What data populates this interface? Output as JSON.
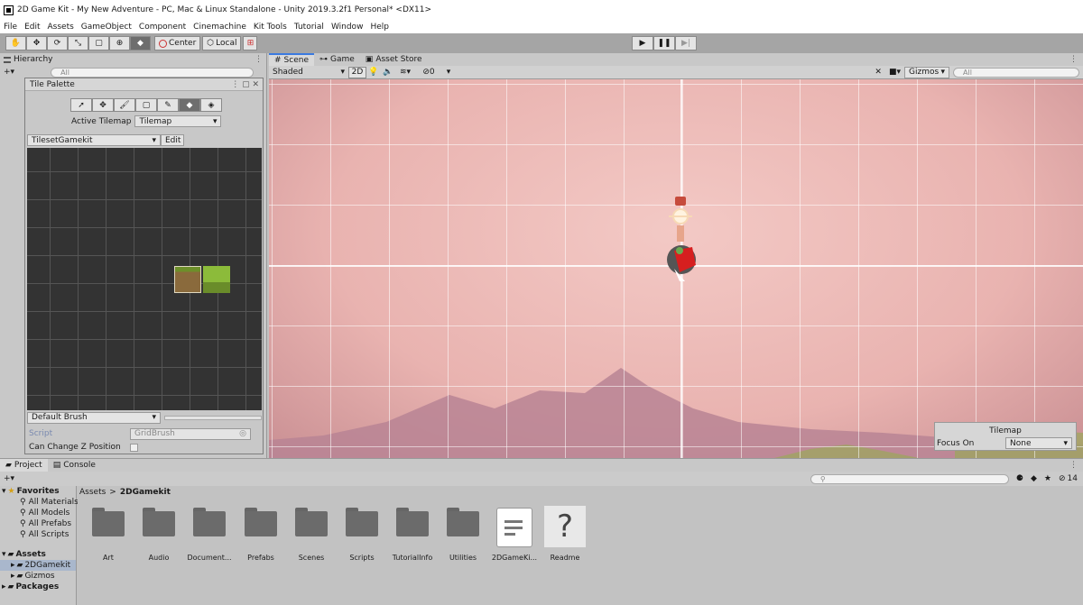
{
  "window": {
    "title": "2D Game Kit - My New Adventure - PC, Mac & Linux Standalone - Unity 2019.3.2f1 Personal* <DX11>"
  },
  "menu": [
    "File",
    "Edit",
    "Assets",
    "GameObject",
    "Component",
    "Cinemachine",
    "Kit Tools",
    "Tutorial",
    "Window",
    "Help"
  ],
  "toolbar": {
    "pivot_center": "Center",
    "pivot_local": "Local"
  },
  "hierarchy": {
    "tab": "Hierarchy",
    "add": "+▾",
    "search_placeholder": "All"
  },
  "tile_palette": {
    "title": "Tile Palette",
    "active_tilemap_label": "Active Tilemap",
    "active_tilemap_value": "Tilemap",
    "palette_name": "TilesetGamekit",
    "edit_label": "Edit",
    "brush": "Default Brush",
    "script_label": "Script",
    "script_value": "GridBrush",
    "can_change_z_label": "Can Change Z Position"
  },
  "scene": {
    "tabs": [
      "Scene",
      "Game",
      "Asset Store"
    ],
    "shading": "Shaded",
    "mode_2d": "2D",
    "effects_count": "0",
    "gizmos": "Gizmos",
    "search_placeholder": "All",
    "overlay": {
      "title": "Tilemap",
      "focus_label": "Focus On",
      "focus_value": "None"
    }
  },
  "project": {
    "tabs": [
      "Project",
      "Console"
    ],
    "add": "+▾",
    "count": "14",
    "favorites": {
      "title": "Favorites",
      "items": [
        "All Materials",
        "All Models",
        "All Prefabs",
        "All Scripts"
      ]
    },
    "assets": {
      "title": "Assets",
      "items": [
        "2DGamekit",
        "Gizmos"
      ]
    },
    "packages": "Packages",
    "breadcrumb": [
      "Assets",
      "2DGamekit"
    ],
    "files": [
      {
        "name": "Art",
        "kind": "folder"
      },
      {
        "name": "Audio",
        "kind": "folder"
      },
      {
        "name": "Document...",
        "kind": "folder"
      },
      {
        "name": "Prefabs",
        "kind": "folder"
      },
      {
        "name": "Scenes",
        "kind": "folder"
      },
      {
        "name": "Scripts",
        "kind": "folder"
      },
      {
        "name": "TutorialInfo",
        "kind": "folder"
      },
      {
        "name": "Utilities",
        "kind": "folder"
      },
      {
        "name": "2DGameKi...",
        "kind": "document"
      },
      {
        "name": "Readme",
        "kind": "help"
      }
    ]
  }
}
